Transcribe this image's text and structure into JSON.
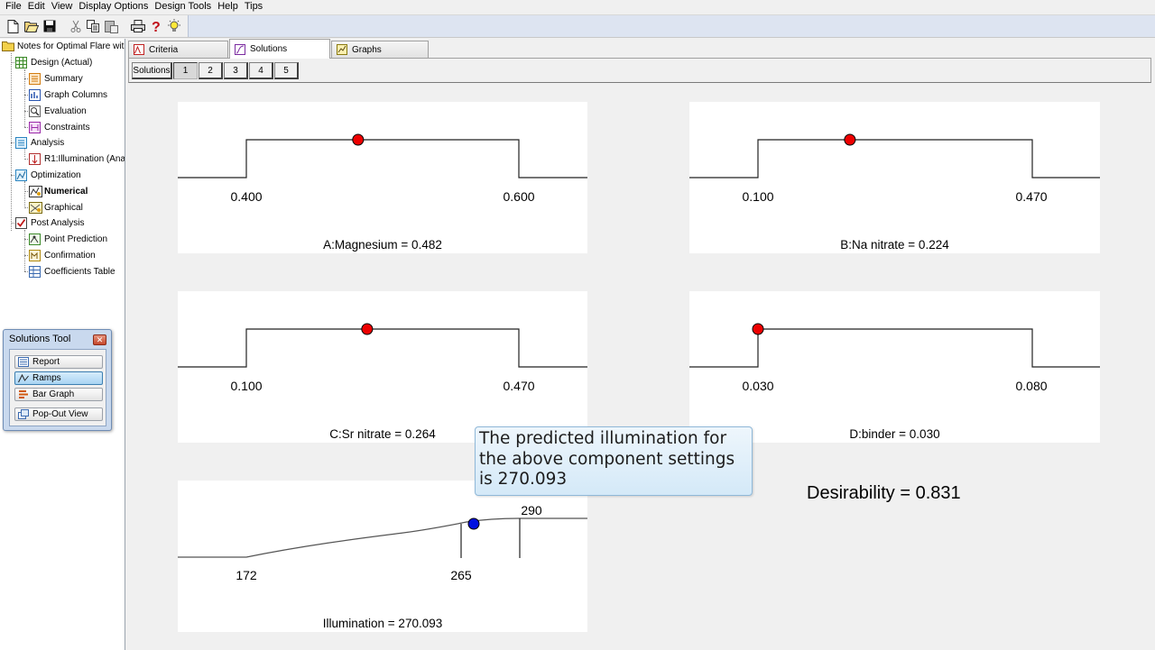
{
  "menu": [
    "File",
    "Edit",
    "View",
    "Display Options",
    "Design Tools",
    "Help",
    "Tips"
  ],
  "toolbar": {
    "icons": [
      "new-icon",
      "open-icon",
      "save-icon",
      "cut-icon",
      "copy-icon",
      "paste-icon",
      "print-icon",
      "help-icon",
      "tip-icon"
    ]
  },
  "tree": {
    "root": "Notes for Optimal Flare wit",
    "design": "Design (Actual)",
    "summary": "Summary",
    "graph_columns": "Graph Columns",
    "evaluation": "Evaluation",
    "constraints": "Constraints",
    "analysis": "Analysis",
    "r1": "R1:Illumination (Anal",
    "optimization": "Optimization",
    "numerical": "Numerical",
    "graphical": "Graphical",
    "post_analysis": "Post Analysis",
    "point_prediction": "Point Prediction",
    "confirmation": "Confirmation",
    "coefficients_table": "Coefficients Table"
  },
  "solutions_tool": {
    "title": "Solutions Tool",
    "report": "Report",
    "ramps": "Ramps",
    "bar_graph": "Bar Graph",
    "popout": "Pop-Out View"
  },
  "tabs": {
    "criteria": "Criteria",
    "solutions": "Solutions",
    "graphs": "Graphs"
  },
  "solution_bar": {
    "label": "Solutions",
    "numbers": [
      "1",
      "2",
      "3",
      "4",
      "5"
    ],
    "selected": "1"
  },
  "ramps": [
    {
      "low": "0.400",
      "high": "0.600",
      "caption": "A:Magnesium = 0.482",
      "low_value": 0.4,
      "high_value": 0.6,
      "value": 0.482
    },
    {
      "low": "0.100",
      "high": "0.470",
      "caption": "B:Na nitrate = 0.224",
      "low_value": 0.1,
      "high_value": 0.47,
      "value": 0.224
    },
    {
      "low": "0.100",
      "high": "0.470",
      "caption": "C:Sr nitrate = 0.264",
      "low_value": 0.1,
      "high_value": 0.47,
      "value": 0.264
    },
    {
      "low": "0.030",
      "high": "0.080",
      "caption": "D:binder = 0.030",
      "low_value": 0.03,
      "high_value": 0.08,
      "value": 0.03
    }
  ],
  "response": {
    "low": "172",
    "target": "265",
    "high": "290",
    "caption": "Illumination = 270.093",
    "value": 270.093
  },
  "desirability": "Desirability = 0.831",
  "callout": {
    "line1": "The predicted illumination for",
    "line2": "the above component settings",
    "line3": "is 270.093"
  },
  "colors": {
    "factor_marker": "#ee0000",
    "response_marker": "#0010e0",
    "toolbar_bg": "#dde4f1",
    "callout_bg": "#d9ecf9"
  }
}
